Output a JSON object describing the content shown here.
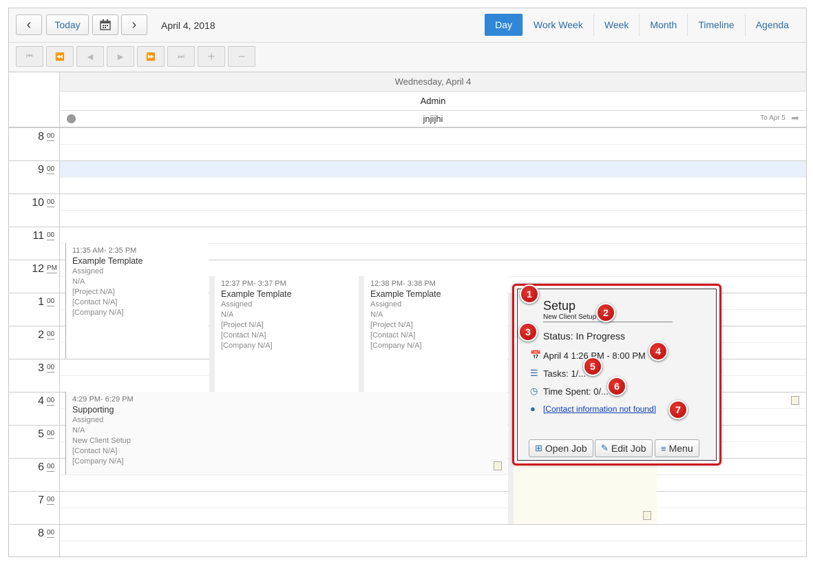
{
  "toolbar": {
    "prev": "<",
    "today": "Today",
    "next": ">",
    "date": "April 4, 2018",
    "views": [
      "Day",
      "Work Week",
      "Week",
      "Month",
      "Timeline",
      "Agenda"
    ],
    "active_view": "Day"
  },
  "nav": {
    "plus": "+",
    "minus": "−"
  },
  "header": {
    "day": "Wednesday, April 4",
    "resource": "Admin",
    "allday_event": "jnjijhi",
    "continues": "To Apr 5"
  },
  "hours": [
    {
      "num": "8",
      "suffix": "00"
    },
    {
      "num": "9",
      "suffix": "00"
    },
    {
      "num": "10",
      "suffix": "00"
    },
    {
      "num": "11",
      "suffix": "00"
    },
    {
      "num": "12",
      "suffix": "PM"
    },
    {
      "num": "1",
      "suffix": "00"
    },
    {
      "num": "2",
      "suffix": "00"
    },
    {
      "num": "3",
      "suffix": "00"
    },
    {
      "num": "4",
      "suffix": "00"
    },
    {
      "num": "5",
      "suffix": "00"
    },
    {
      "num": "6",
      "suffix": "00"
    },
    {
      "num": "7",
      "suffix": "00"
    },
    {
      "num": "8",
      "suffix": "00"
    }
  ],
  "events": [
    {
      "time": "11:35 AM- 2:35 PM",
      "title": "Example Template",
      "l1": "Assigned",
      "l2": "N/A",
      "l3": "[Project N/A]",
      "l4": "[Contact N/A]",
      "l5": "[Company N/A]"
    },
    {
      "time": "12:37 PM- 3:37 PM",
      "title": "Example Template",
      "l1": "Assigned",
      "l2": "N/A",
      "l3": "[Project N/A]",
      "l4": "[Contact N/A]",
      "l5": "[Company N/A]"
    },
    {
      "time": "12:38 PM- 3:38 PM",
      "title": "Example Template",
      "l1": "Assigned",
      "l2": "N/A",
      "l3": "[Project N/A]",
      "l4": "[Contact N/A]",
      "l5": "[Company N/A]"
    },
    {
      "time": "4:29 PM- 6:29 PM",
      "title": "Supporting",
      "l1": "Assigned",
      "l2": "N/A",
      "l3": "New Client Setup",
      "l4": "[Contact N/A]",
      "l5": "[Company N/A]"
    }
  ],
  "popup": {
    "title": "Setup",
    "subtitle": "New Client Setup",
    "status": "Status: In Progress",
    "when": "April 4 1:26 PM - 8:00 PM",
    "tasks": "Tasks: 1/...",
    "time_spent": "Time Spent: 0/...",
    "contact": "[Contact information not found]",
    "open": "Open Job",
    "edit": "Edit Job",
    "menu": "Menu",
    "badges": [
      "1",
      "2",
      "3",
      "4",
      "5",
      "6",
      "7"
    ]
  },
  "colors": {
    "accent": "#2f87d6",
    "highlight": "#d0171b",
    "current_row": "#e8f1fb"
  }
}
